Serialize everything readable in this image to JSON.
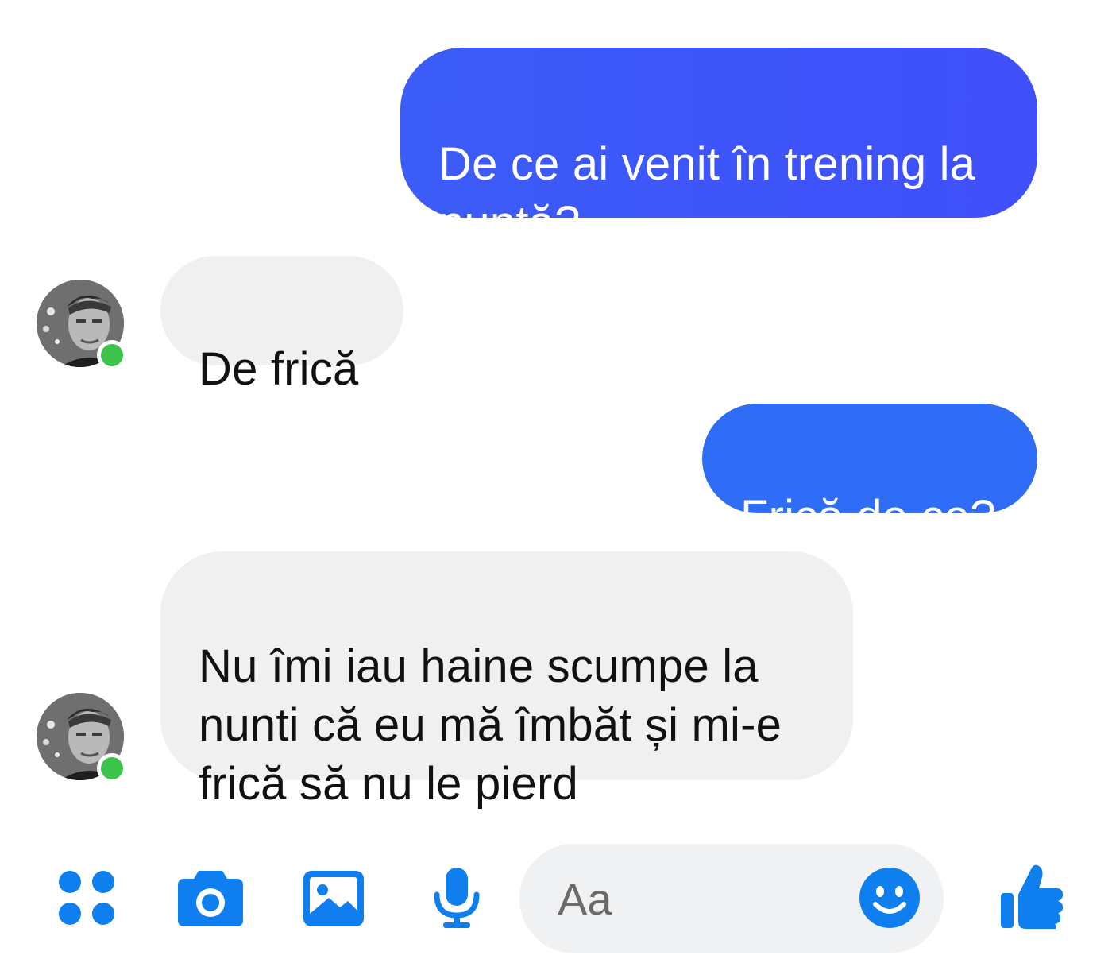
{
  "messages": [
    {
      "from": "me",
      "text": "De ce ai venit în trening la\nnuntă?"
    },
    {
      "from": "contact",
      "text": "De frică"
    },
    {
      "from": "me",
      "text": "Frică de ce?"
    },
    {
      "from": "contact",
      "text": "Nu îmi iau haine scumpe la\nnunti că eu mă îmbăt și mi-e\nfrică să nu le pierd"
    }
  ],
  "contact": {
    "avatar_icon": "profile-photo",
    "status": "online"
  },
  "toolbar": {
    "icons": [
      "apps-grid-icon",
      "camera-icon",
      "gallery-icon",
      "microphone-icon",
      "smiley-icon",
      "thumbs-up-icon"
    ],
    "placeholder": "Aa"
  },
  "colors": {
    "sent_bubble": "#3b5cf7",
    "sent_bubble_alt": "#2f6df6",
    "received_bubble": "#f0f0f0",
    "accent": "#0f7ff0",
    "online": "#3bc34a"
  }
}
